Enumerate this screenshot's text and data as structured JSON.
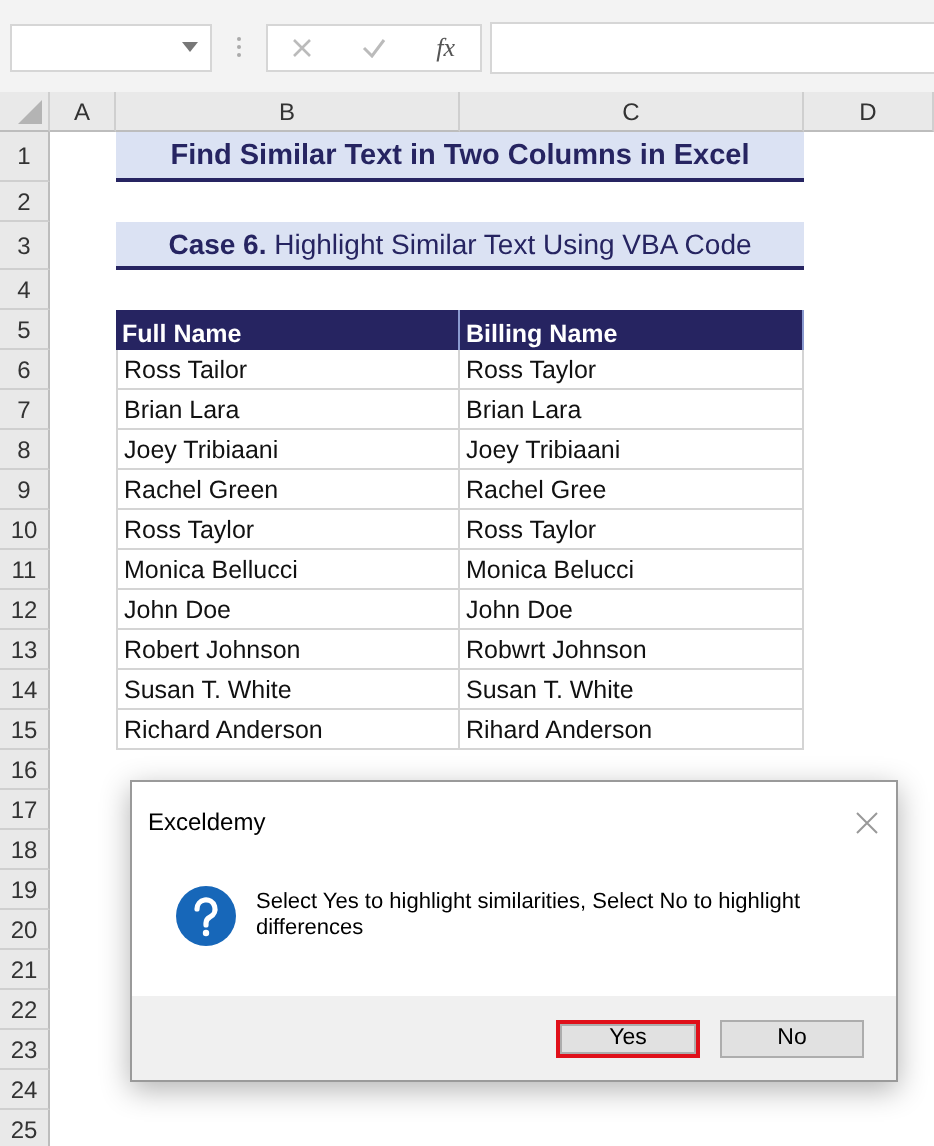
{
  "formula_bar": {
    "function_label": "fx"
  },
  "columns": [
    "A",
    "B",
    "C",
    "D"
  ],
  "rows": [
    "1",
    "2",
    "3",
    "4",
    "5",
    "6",
    "7",
    "8",
    "9",
    "10",
    "11",
    "12",
    "13",
    "14",
    "15",
    "16",
    "17",
    "18",
    "19",
    "20",
    "21",
    "22",
    "23",
    "24",
    "25"
  ],
  "title": "Find Similar Text in Two Columns in Excel",
  "subtitle": "**Case 6.** Highlight Similar Text Using VBA Code",
  "table": {
    "columns": [
      "Full Name",
      "Billing Name"
    ],
    "rows": [
      [
        "Ross Tailor",
        "Ross Taylor"
      ],
      [
        "Brian Lara",
        "Brian Lara"
      ],
      [
        "Joey Tribiaani",
        "Joey Tribiaani"
      ],
      [
        "Rachel Green",
        "Rachel Gree"
      ],
      [
        "Ross Taylor",
        "Ross Taylor"
      ],
      [
        "Monica Bellucci",
        "Monica Belucci"
      ],
      [
        "John Doe",
        "John Doe"
      ],
      [
        "Robert Johnson",
        "Robwrt Johnson"
      ],
      [
        "Susan T. White",
        "Susan T. White"
      ],
      [
        "Richard Anderson",
        "Rihard Anderson"
      ]
    ]
  },
  "dialog": {
    "title": "Exceldemy",
    "message": "Select Yes to highlight similarities, Select No to highlight differences",
    "buttons": [
      {
        "label": "Yes",
        "highlighted": true
      },
      {
        "label": "No",
        "highlighted": false
      }
    ]
  }
}
